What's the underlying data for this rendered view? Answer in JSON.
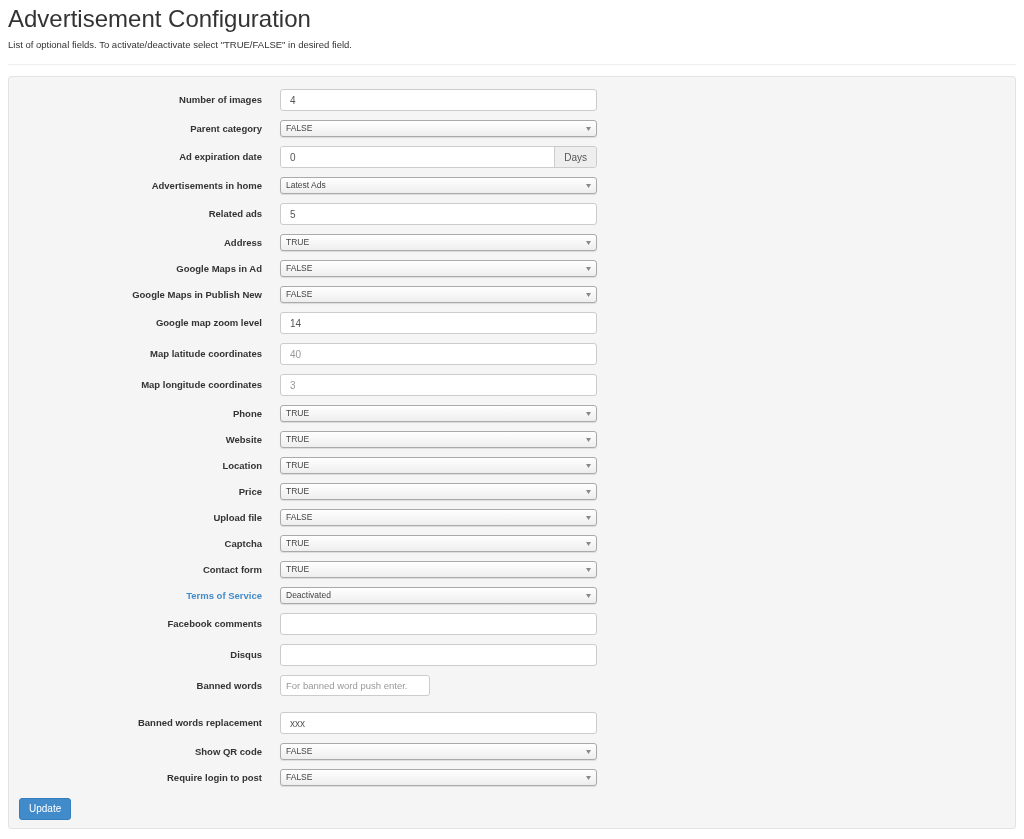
{
  "title": "Advertisement Configuration",
  "description": "List of optional fields. To activate/deactivate select \"TRUE/FALSE\" in desired field.",
  "fields": [
    {
      "label": "Number of images",
      "kind": "text",
      "value": "4"
    },
    {
      "label": "Parent category",
      "kind": "select",
      "value": "FALSE"
    },
    {
      "label": "Ad expiration date",
      "kind": "addon",
      "value": "0",
      "addon": "Days"
    },
    {
      "label": "Advertisements in home",
      "kind": "select",
      "value": "Latest Ads"
    },
    {
      "label": "Related ads",
      "kind": "text",
      "value": "5"
    },
    {
      "label": "Address",
      "kind": "select",
      "value": "TRUE"
    },
    {
      "label": "Google Maps in Ad",
      "kind": "select",
      "value": "FALSE"
    },
    {
      "label": "Google Maps in Publish New",
      "kind": "select",
      "value": "FALSE"
    },
    {
      "label": "Google map zoom level",
      "kind": "text",
      "value": "14"
    },
    {
      "label": "Map latitude coordinates",
      "kind": "text",
      "placeholder": "40"
    },
    {
      "label": "Map longitude coordinates",
      "kind": "text",
      "placeholder": "3"
    },
    {
      "label": "Phone",
      "kind": "select",
      "value": "TRUE"
    },
    {
      "label": "Website",
      "kind": "select",
      "value": "TRUE"
    },
    {
      "label": "Location",
      "kind": "select",
      "value": "TRUE"
    },
    {
      "label": "Price",
      "kind": "select",
      "value": "TRUE"
    },
    {
      "label": "Upload file",
      "kind": "select",
      "value": "FALSE"
    },
    {
      "label": "Captcha",
      "kind": "select",
      "value": "TRUE"
    },
    {
      "label": "Contact form",
      "kind": "select",
      "value": "TRUE"
    },
    {
      "label": "Terms of Service",
      "link": true,
      "kind": "select",
      "value": "Deactivated"
    },
    {
      "label": "Facebook comments",
      "kind": "text"
    },
    {
      "label": "Disqus",
      "kind": "text"
    },
    {
      "label": "Banned words",
      "kind": "tags",
      "placeholder": "For banned word push enter."
    },
    {
      "label": "Banned words replacement",
      "kind": "text",
      "value": "xxx"
    },
    {
      "label": "Show QR code",
      "kind": "select",
      "value": "FALSE"
    },
    {
      "label": "Require login to post",
      "kind": "select",
      "value": "FALSE"
    }
  ],
  "button": "Update"
}
